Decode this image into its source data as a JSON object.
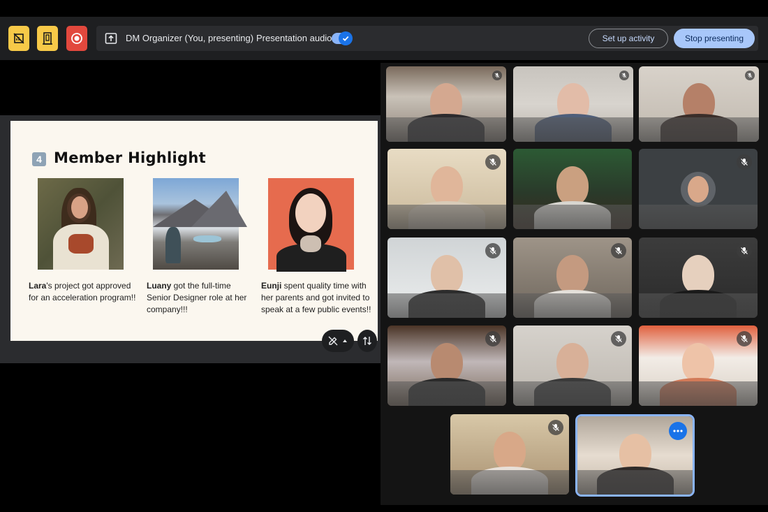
{
  "toolbar": {
    "presenter_label": "DM Organizer (You, presenting)",
    "audio_label": "Presentation audio",
    "setup_label": "Set up activity",
    "stop_label": "Stop presenting"
  },
  "slide": {
    "number": "4",
    "title": "Member Highlight",
    "members": [
      {
        "name": "Lara",
        "text": "'s project got approved for an acceleration program!!"
      },
      {
        "name": "Luany",
        "text": " got the full-time Senior Designer role at her company!!!"
      },
      {
        "name": "Eunji",
        "text": " spent quality time with her parents and got invited to speak at a few public events!!"
      }
    ]
  },
  "colors": {
    "accent": "#8ab4f8",
    "record": "#e2483d",
    "highlight": "#f7c948"
  }
}
